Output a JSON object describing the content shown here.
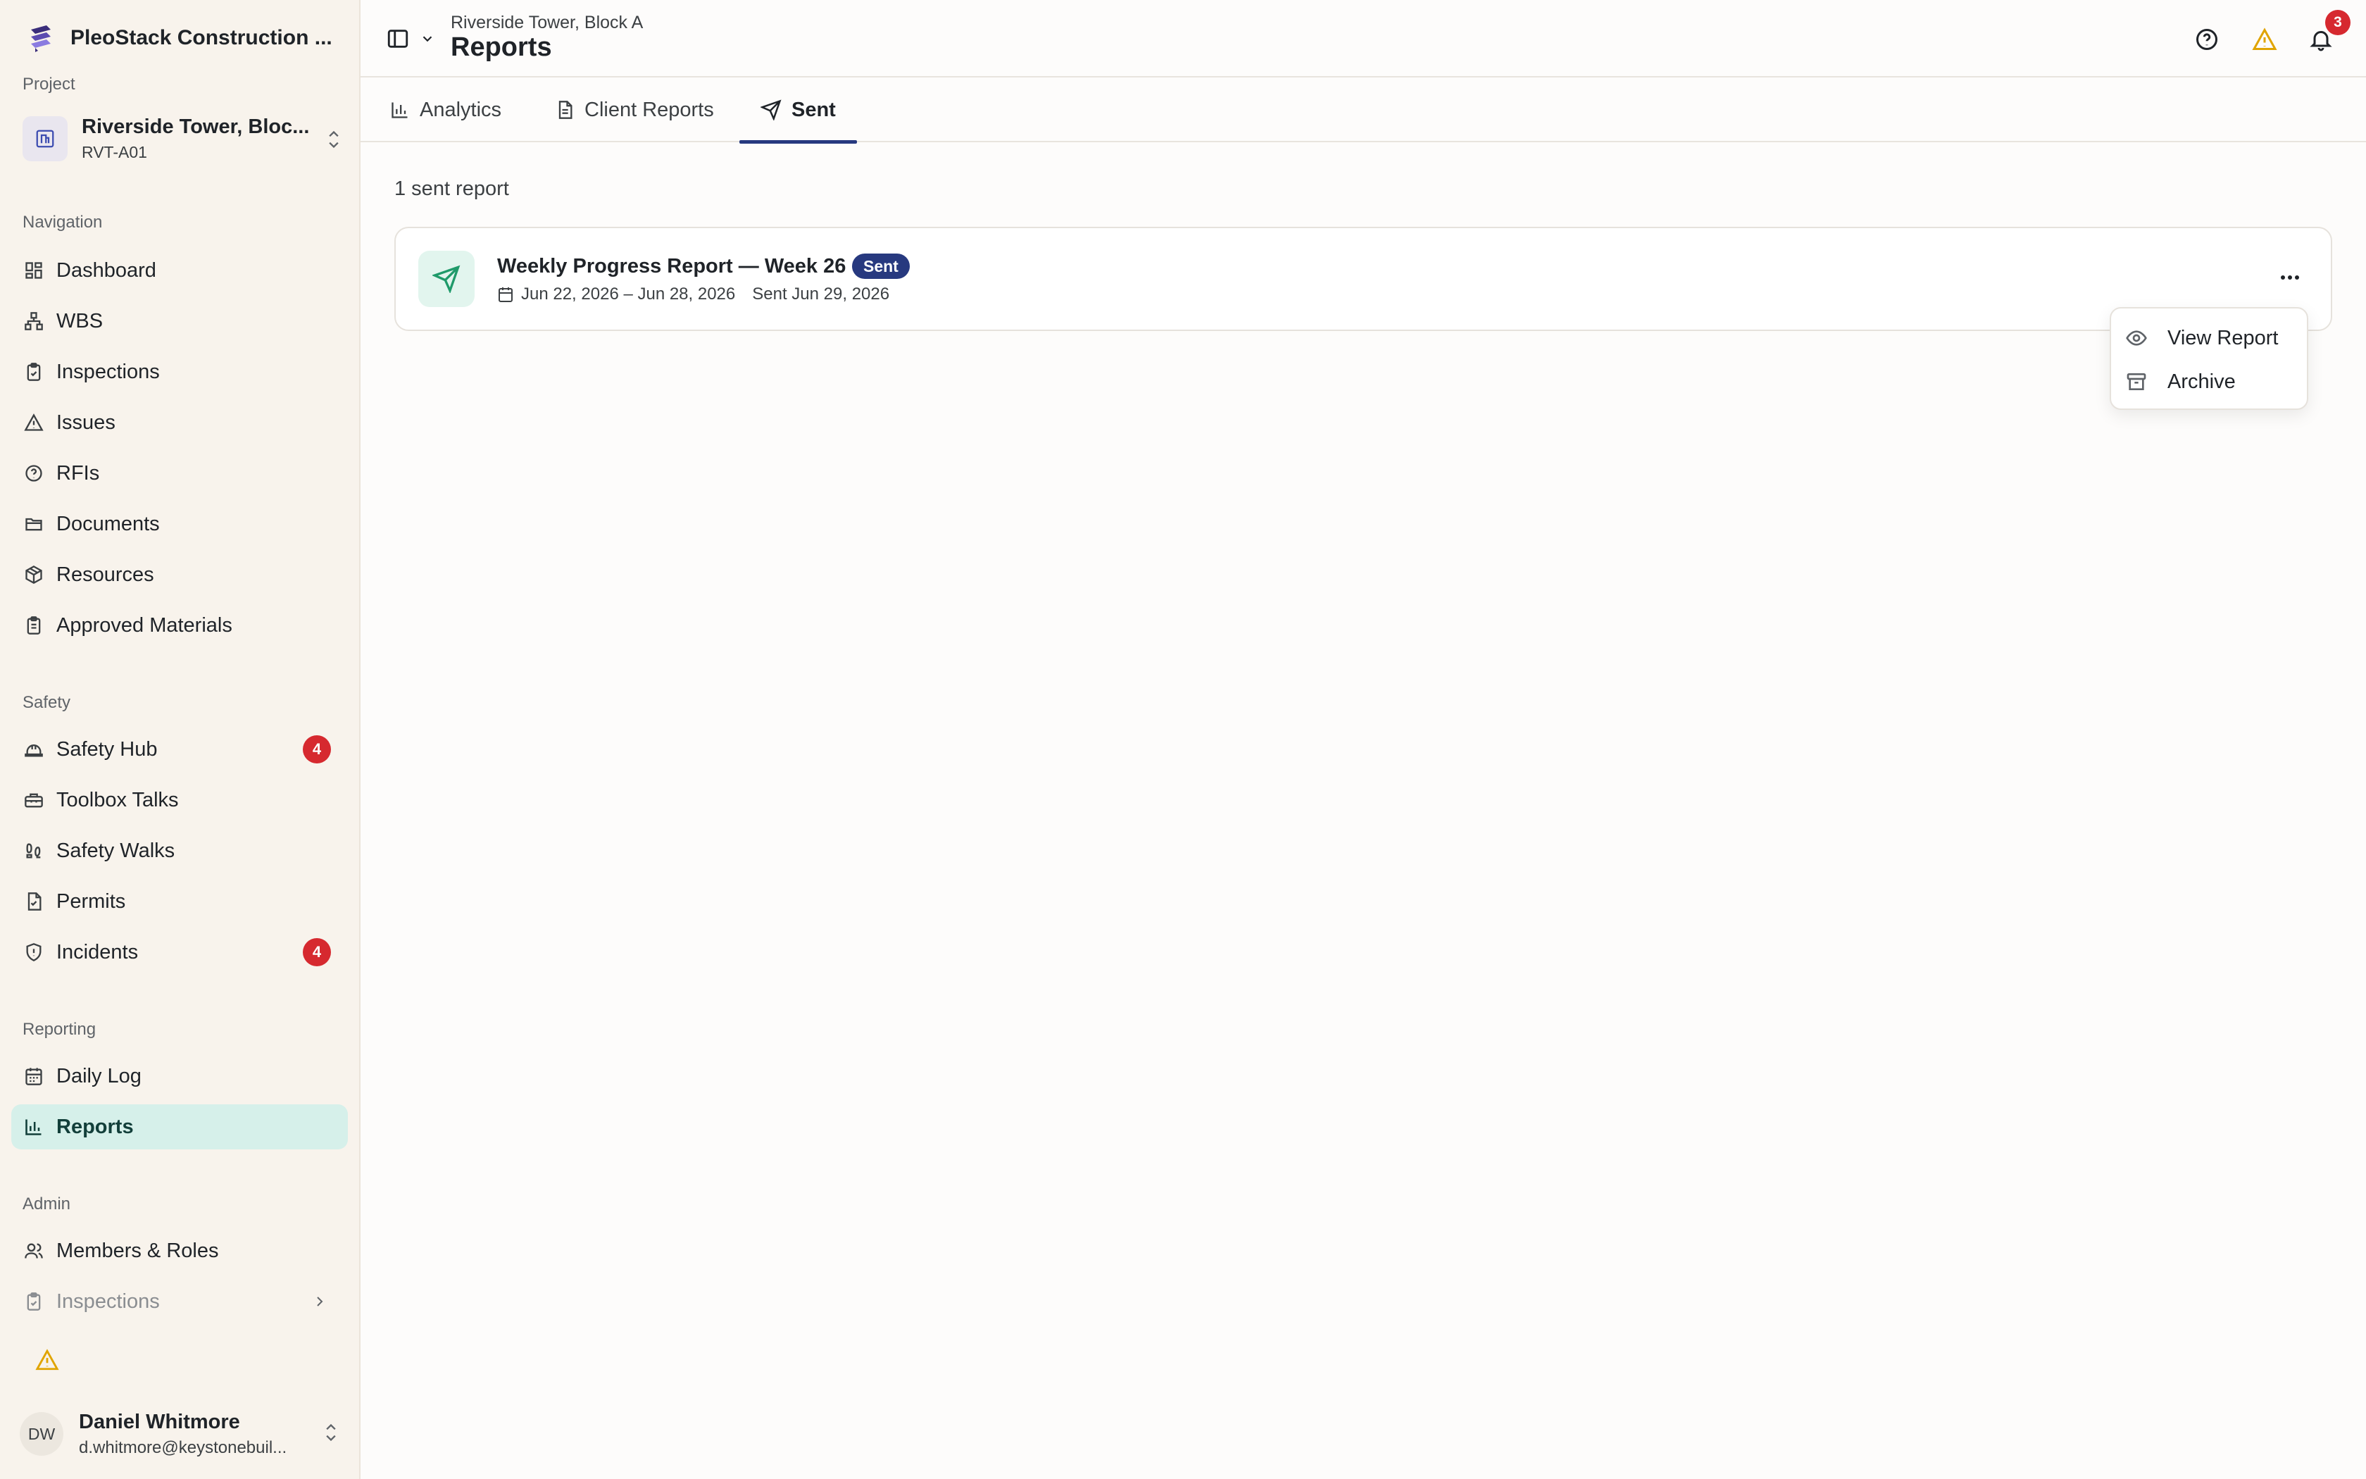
{
  "app": {
    "name": "PleoStack Construction ..."
  },
  "sidebar": {
    "project_label": "Project",
    "project": {
      "name": "Riverside Tower, Bloc...",
      "code": "RVT-A01"
    },
    "sections": {
      "navigation": "Navigation",
      "safety": "Safety",
      "reporting": "Reporting",
      "admin": "Admin"
    },
    "items": {
      "dashboard": "Dashboard",
      "wbs": "WBS",
      "inspections": "Inspections",
      "issues": "Issues",
      "rfis": "RFIs",
      "documents": "Documents",
      "resources": "Resources",
      "approved_materials": "Approved Materials",
      "safety_hub": "Safety Hub",
      "toolbox_talks": "Toolbox Talks",
      "safety_walks": "Safety Walks",
      "permits": "Permits",
      "incidents": "Incidents",
      "daily_log": "Daily Log",
      "reports": "Reports",
      "members_roles": "Members & Roles",
      "admin_inspections": "Inspections"
    },
    "badges": {
      "safety_hub": "4",
      "incidents": "4"
    },
    "user": {
      "initials": "DW",
      "name": "Daniel Whitmore",
      "email": "d.whitmore@keystonebuil..."
    }
  },
  "header": {
    "breadcrumb": "Riverside Tower, Block A",
    "title": "Reports",
    "notifications_count": "3"
  },
  "tabs": [
    {
      "label": "Analytics",
      "icon": "bar-chart-icon"
    },
    {
      "label": "Client Reports",
      "icon": "document-icon"
    },
    {
      "label": "Sent",
      "icon": "send-icon",
      "active": true
    }
  ],
  "main": {
    "count_text": "1 sent report",
    "report": {
      "title": "Weekly Progress Report — Week 26",
      "status": "Sent",
      "date_range": "Jun 22, 2026 – Jun 28, 2026",
      "sent_on": "Sent Jun 29, 2026"
    },
    "menu": {
      "view": "View Report",
      "archive": "Archive"
    }
  },
  "colors": {
    "accent_navy": "#27397f",
    "active_nav_bg": "#d6f0ea",
    "badge_red": "#d6292f",
    "warning": "#e0a400",
    "send_green": "#1f9a6a"
  }
}
